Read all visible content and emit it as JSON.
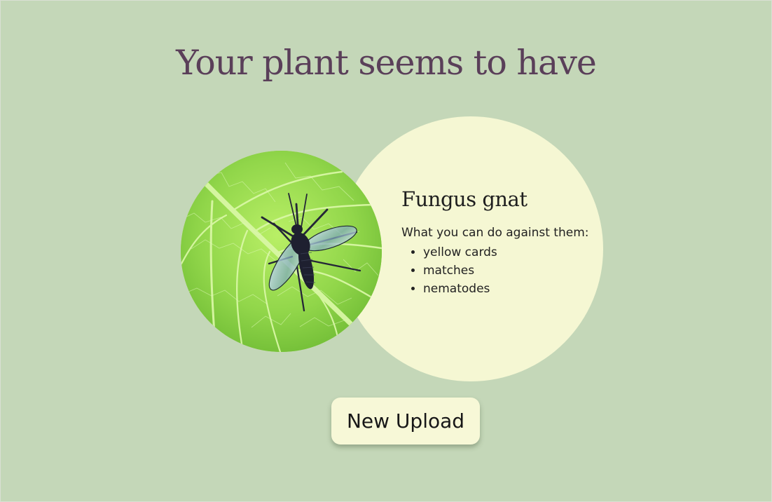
{
  "page": {
    "title": "Your plant seems to have",
    "background_color": "#c4d7b8",
    "title_color": "#5a3f59"
  },
  "result": {
    "pest_name": "Fungus gnat",
    "image_subject": "fungus gnat on a green leaf",
    "card_color": "#f5f7d3",
    "advice_heading": "What you can do against them:",
    "remedies": [
      "yellow cards",
      "matches",
      "nematodes"
    ]
  },
  "actions": {
    "new_upload_label": "New Upload",
    "button_color": "#f7f8d7"
  }
}
